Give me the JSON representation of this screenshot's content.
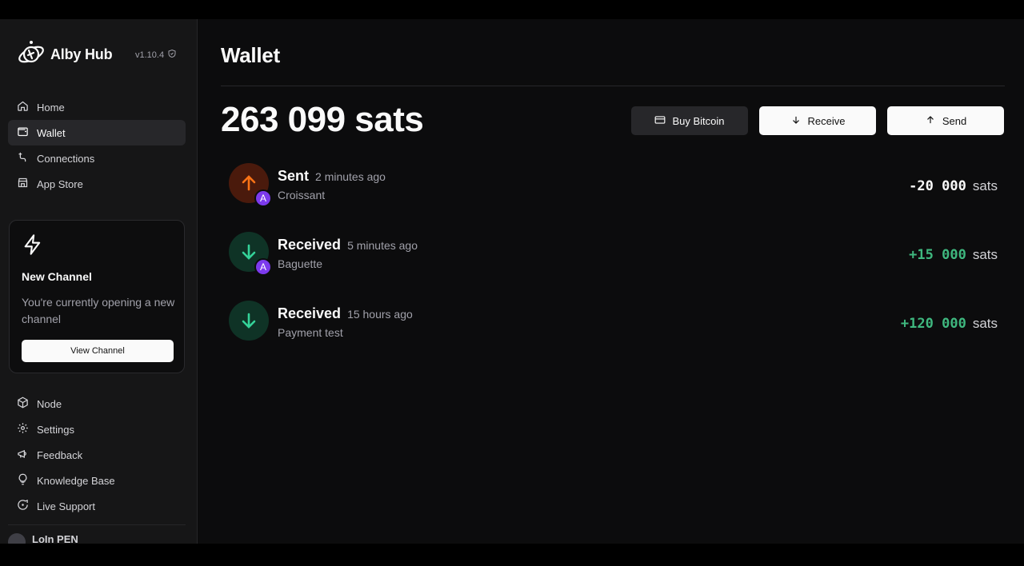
{
  "app": {
    "name": "Alby Hub",
    "version": "v1.10.4"
  },
  "sidebar": {
    "top_items": [
      {
        "label": "Home",
        "icon": "home-icon",
        "active": false
      },
      {
        "label": "Wallet",
        "icon": "wallet-icon",
        "active": true
      },
      {
        "label": "Connections",
        "icon": "connections-icon",
        "active": false
      },
      {
        "label": "App Store",
        "icon": "store-icon",
        "active": false
      }
    ],
    "channel_card": {
      "title": "New Channel",
      "description": "You're currently opening a new channel",
      "button": "View Channel",
      "icon": "zap-icon"
    },
    "bottom_items": [
      {
        "label": "Node",
        "icon": "box-icon"
      },
      {
        "label": "Settings",
        "icon": "gear-icon"
      },
      {
        "label": "Feedback",
        "icon": "megaphone-icon"
      },
      {
        "label": "Knowledge Base",
        "icon": "lightbulb-icon"
      },
      {
        "label": "Live Support",
        "icon": "chat-icon"
      }
    ],
    "user_name": "LoIn PEN"
  },
  "main": {
    "title": "Wallet",
    "balance": "263 099 sats",
    "actions": {
      "buy": "Buy Bitcoin",
      "receive": "Receive",
      "send": "Send"
    },
    "transactions": [
      {
        "type": "Sent",
        "time": "2 minutes ago",
        "description": "Croissant",
        "amount": "-20 000",
        "unit": "sats",
        "direction": "out",
        "badge": "A"
      },
      {
        "type": "Received",
        "time": "5 minutes ago",
        "description": "Baguette",
        "amount": "+15 000",
        "unit": "sats",
        "direction": "in",
        "badge": "A"
      },
      {
        "type": "Received",
        "time": "15 hours ago",
        "description": "Payment test",
        "amount": "+120 000",
        "unit": "sats",
        "direction": "in",
        "badge": ""
      }
    ]
  },
  "colors": {
    "accent_positive": "#3fb87f",
    "sent_icon": "#f97316",
    "received_icon": "#34d399",
    "badge": "#7c3aed"
  }
}
